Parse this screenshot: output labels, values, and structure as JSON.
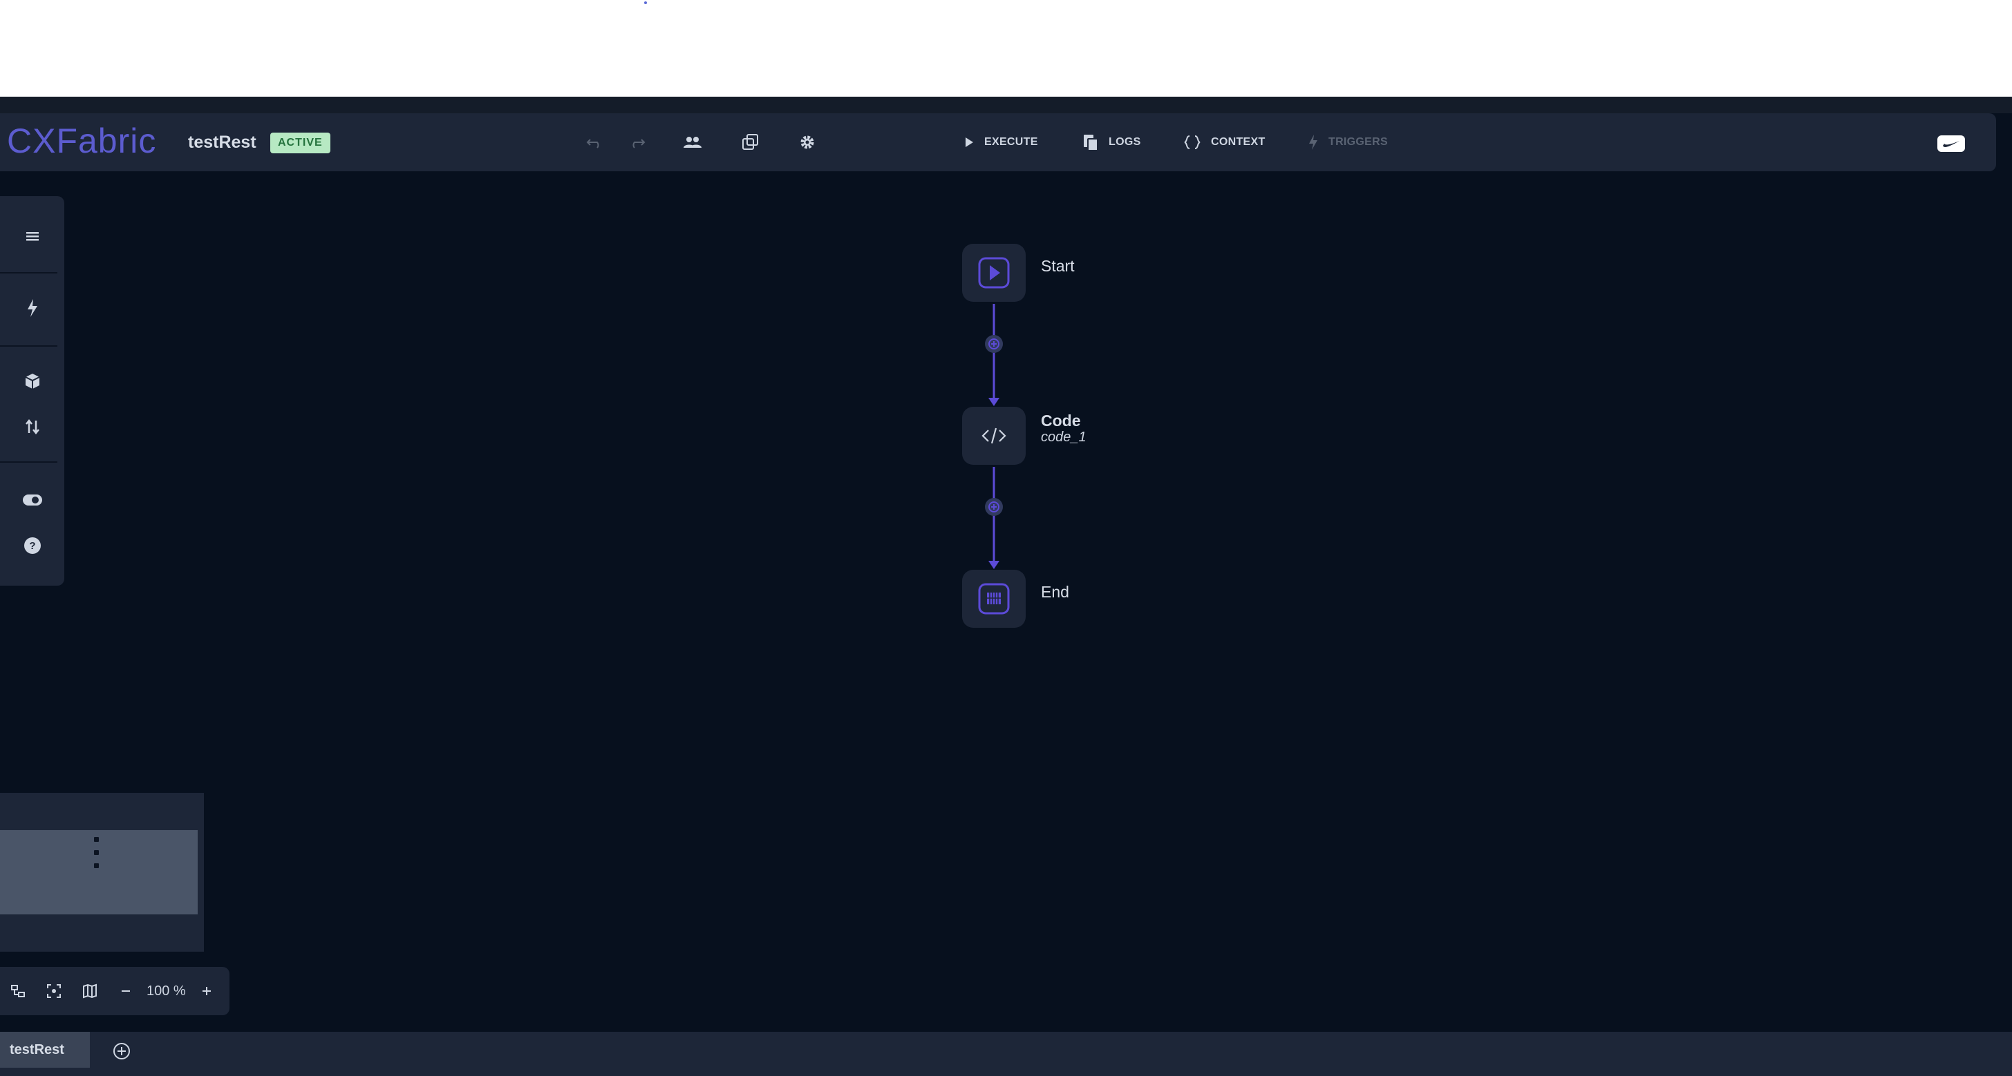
{
  "header": {
    "logo": "CXFabric",
    "flow_name": "testRest",
    "status": "ACTIVE",
    "actions": {
      "execute": "EXECUTE",
      "logs": "LOGS",
      "context": "CONTEXT",
      "triggers": "TRIGGERS"
    }
  },
  "flow": {
    "nodes": [
      {
        "title": "Start",
        "subtitle": ""
      },
      {
        "title": "Code",
        "subtitle": "code_1"
      },
      {
        "title": "End",
        "subtitle": ""
      }
    ]
  },
  "zoom": {
    "value": "100 %"
  },
  "tabs": [
    {
      "label": "testRest"
    }
  ],
  "colors": {
    "canvas": "#07101e",
    "panel": "#1d2638",
    "accent": "#5c4bd8",
    "badge_bg": "#b7e9c3",
    "badge_text": "#25733e"
  }
}
